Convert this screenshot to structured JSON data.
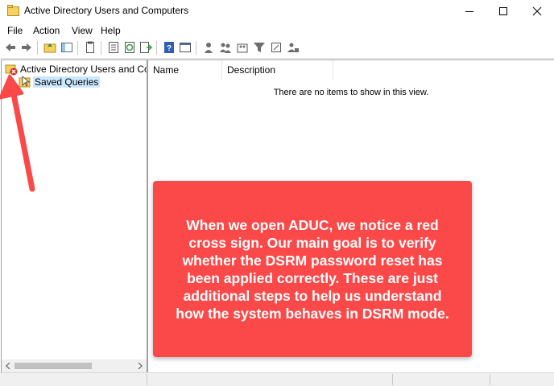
{
  "window": {
    "title": "Active Directory Users and Computers"
  },
  "menu": [
    "File",
    "Action",
    "View",
    "Help"
  ],
  "toolbar_icons": [
    "back-icon",
    "forward-icon",
    "up-folder-icon",
    "show-tree-icon",
    "properties-icon",
    "export-list-icon",
    "refresh-icon",
    "export-icon",
    "help-icon",
    "console-icon",
    "user-icon",
    "users-icon",
    "group-icon",
    "filter-icon",
    "add-to-group-icon",
    "delegate-icon"
  ],
  "tree": {
    "root_label": "Active Directory Users and Com",
    "child_label": "Saved Queries"
  },
  "list": {
    "columns": [
      "Name",
      "Description"
    ],
    "empty_message": "There are no items to show in this view."
  },
  "annotation": {
    "text": "When we open ADUC, we notice a red cross sign. Our main goal is to verify whether the DSRM password reset has been applied correctly. These are just additional steps to help us understand how the system behaves in DSRM mode.",
    "color": "#fb4848"
  }
}
